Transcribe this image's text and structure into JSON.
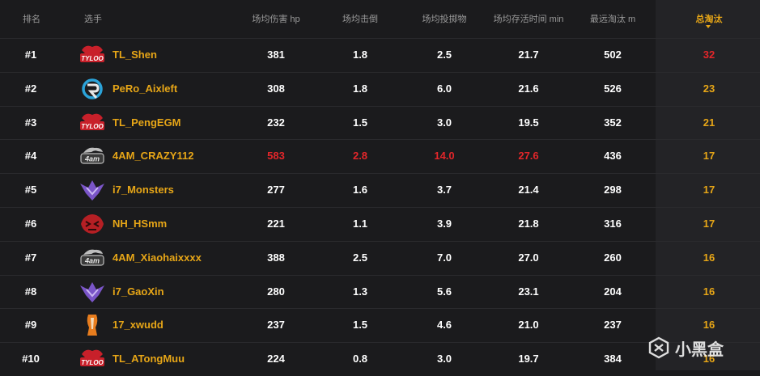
{
  "header": {
    "rank": "排名",
    "player": "选手",
    "damage": "场均伤害 hp",
    "kills_avg": "场均击倒",
    "throwables": "场均投掷物",
    "survival": "场均存活时间 min",
    "longest_kill": "最远淘汰 m",
    "total_kills": "总淘汰"
  },
  "colors": {
    "accent": "#e7a617",
    "highlight": "#e3262a",
    "background": "#1b1b1d"
  },
  "rows": [
    {
      "rank": "#1",
      "team": "TYLOO",
      "logo": "tyloo-logo-icon",
      "name": "TL_Shen",
      "damage": "381",
      "knocks": "1.8",
      "throwables": "2.5",
      "survival": "21.7",
      "longest": "502",
      "kills": "32",
      "kills_highlight": true
    },
    {
      "rank": "#2",
      "team": "PeRo",
      "logo": "pero-logo-icon",
      "name": "PeRo_Aixleft",
      "damage": "308",
      "knocks": "1.8",
      "throwables": "6.0",
      "survival": "21.6",
      "longest": "526",
      "kills": "23"
    },
    {
      "rank": "#3",
      "team": "TYLOO",
      "logo": "tyloo-logo-icon",
      "name": "TL_PengEGM",
      "damage": "232",
      "knocks": "1.5",
      "throwables": "3.0",
      "survival": "19.5",
      "longest": "352",
      "kills": "21"
    },
    {
      "rank": "#4",
      "team": "4AM",
      "logo": "4am-logo-icon",
      "name": "4AM_CRAZY112",
      "damage": "583",
      "knocks": "2.8",
      "throwables": "14.0",
      "survival": "27.6",
      "longest": "436",
      "kills": "17",
      "highlight": [
        "damage",
        "knocks",
        "throwables",
        "survival"
      ]
    },
    {
      "rank": "#5",
      "team": "i7",
      "logo": "i7-logo-icon",
      "name": "i7_Monsters",
      "damage": "277",
      "knocks": "1.6",
      "throwables": "3.7",
      "survival": "21.4",
      "longest": "298",
      "kills": "17"
    },
    {
      "rank": "#6",
      "team": "NH",
      "logo": "nh-logo-icon",
      "name": "NH_HSmm",
      "damage": "221",
      "knocks": "1.1",
      "throwables": "3.9",
      "survival": "21.8",
      "longest": "316",
      "kills": "17"
    },
    {
      "rank": "#7",
      "team": "4AM",
      "logo": "4am-logo-icon",
      "name": "4AM_Xiaohaixxxx",
      "damage": "388",
      "knocks": "2.5",
      "throwables": "7.0",
      "survival": "27.0",
      "longest": "260",
      "kills": "16"
    },
    {
      "rank": "#8",
      "team": "i7",
      "logo": "i7-logo-icon",
      "name": "i7_GaoXin",
      "damage": "280",
      "knocks": "1.3",
      "throwables": "5.6",
      "survival": "23.1",
      "longest": "204",
      "kills": "16"
    },
    {
      "rank": "#9",
      "team": "17",
      "logo": "17-logo-icon",
      "name": "17_xwudd",
      "damage": "237",
      "knocks": "1.5",
      "throwables": "4.6",
      "survival": "21.0",
      "longest": "237",
      "kills": "16"
    },
    {
      "rank": "#10",
      "team": "TYLOO",
      "logo": "tyloo-logo-icon",
      "name": "TL_ATongMuu",
      "damage": "224",
      "knocks": "0.8",
      "throwables": "3.0",
      "survival": "19.7",
      "longest": "384",
      "kills": "16"
    }
  ],
  "watermark": {
    "text": "小黑盒",
    "icon": "xiaoheihe-logo-icon"
  }
}
